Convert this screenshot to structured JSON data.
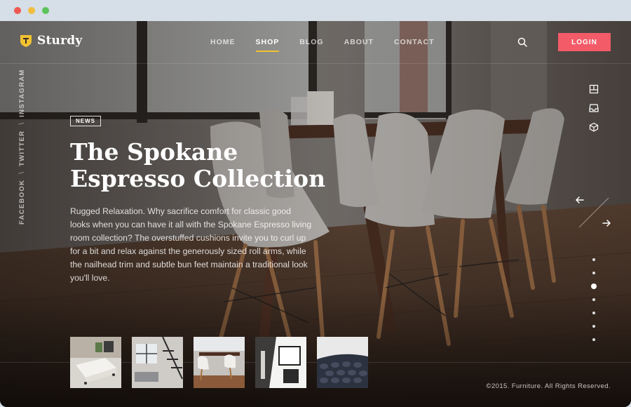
{
  "brand": {
    "name": "Sturdy",
    "accent": "#f2c230"
  },
  "nav": {
    "items": [
      {
        "label": "HOME"
      },
      {
        "label": "SHOP"
      },
      {
        "label": "BLOG"
      },
      {
        "label": "ABOUT"
      },
      {
        "label": "CONTACT"
      }
    ],
    "active": "SHOP"
  },
  "header": {
    "search_icon": "search-icon",
    "login_label": "LOGIN",
    "login_color": "#f35b68"
  },
  "social": {
    "links": [
      "FACEBOOK",
      "TWITTER",
      "INSTAGRAM"
    ],
    "separator": "\\"
  },
  "hero": {
    "tag": "NEWS",
    "title_line1": "The Spokane",
    "title_line2": "Espresso Collection",
    "body": "Rugged Relaxation. Why sacrifice comfort for classic good looks when you can have it all with the Spokane Espresso living room collection? The overstuffed cushions invite you to curl up for a bit and relax against the generously sized roll arms, while the nailhead trim and subtle bun feet maintain a traditional look you'll love."
  },
  "side_icons": [
    "book-icon",
    "inbox-icon",
    "cube-icon"
  ],
  "slider": {
    "prev_icon": "arrow-left-icon",
    "next_icon": "arrow-right-icon",
    "dot_count": 7,
    "active_dot": 3
  },
  "thumbnails": [
    "living-room-table",
    "loft-staircase",
    "dining-chairs",
    "white-interior",
    "leather-sofa"
  ],
  "footer": {
    "copyright": "©2015. Furniture. All Rights Reserved."
  }
}
